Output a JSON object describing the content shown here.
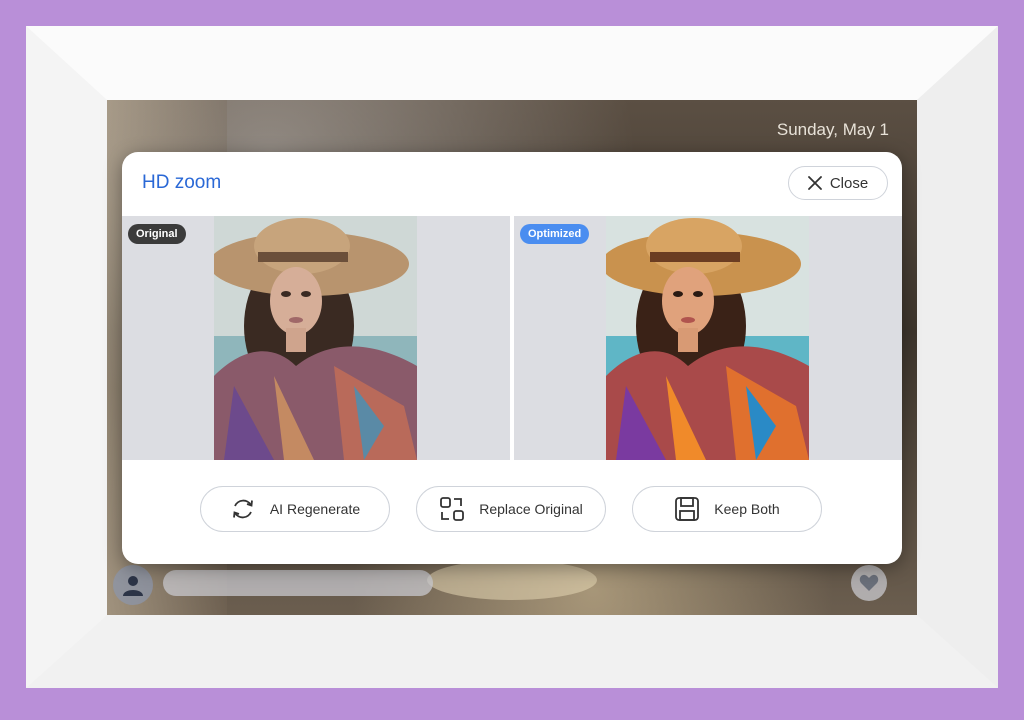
{
  "screen": {
    "date": "Sunday, May 1"
  },
  "modal": {
    "title": "HD zoom",
    "close_label": "Close",
    "original_badge": "Original",
    "optimized_badge": "Optimized",
    "actions": [
      {
        "label": "AI Regenerate",
        "icon": "refresh-icon"
      },
      {
        "label": "Replace Original",
        "icon": "replace-icon"
      },
      {
        "label": "Keep Both",
        "icon": "save-icon"
      }
    ]
  },
  "colors": {
    "frame_border": "#b98fd8",
    "title_blue": "#2a68d6",
    "optimized_badge": "#4a8df0",
    "original_badge": "#3b3b3b"
  }
}
